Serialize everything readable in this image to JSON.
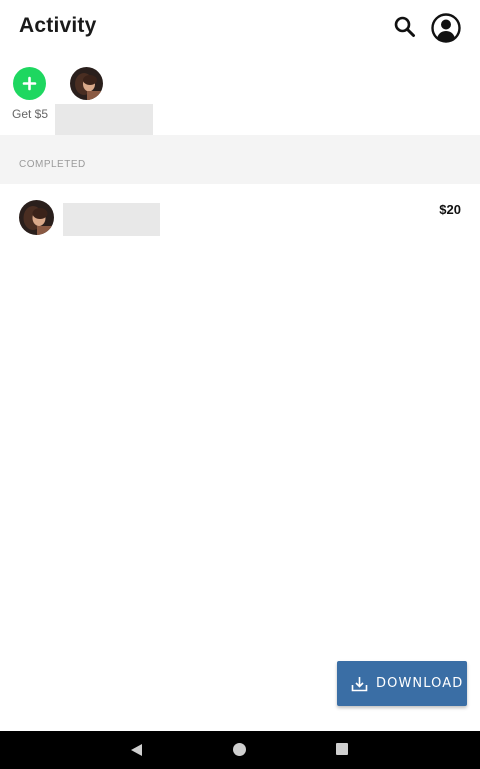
{
  "header": {
    "title": "Activity",
    "search_icon": "search-icon",
    "account_icon": "account-circle-icon"
  },
  "quick_actions": {
    "add_icon": "plus-icon",
    "add_label": "Get $5",
    "accent_color": "#1ed760"
  },
  "section": {
    "label": "COMPLETED"
  },
  "transactions": [
    {
      "amount": "$20"
    }
  ],
  "download_button": {
    "label": "DOWNLOAD",
    "icon": "download-icon",
    "color": "#3a6ea5"
  },
  "system_nav": {
    "back_icon": "back-triangle-icon",
    "home_icon": "home-circle-icon",
    "recents_icon": "recents-square-icon"
  }
}
